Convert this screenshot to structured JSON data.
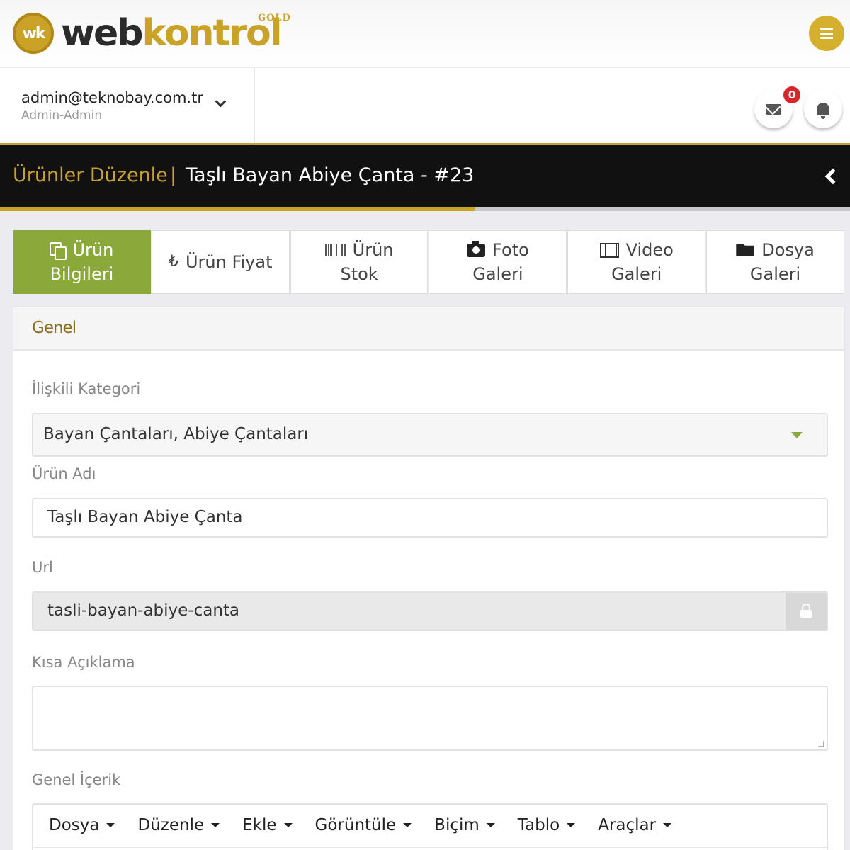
{
  "brand": {
    "badge_text": "wk",
    "name_part1": "web",
    "name_part2": "kontrol",
    "tier": "GOLD",
    "accent_color": "#c9a227"
  },
  "topbar": {
    "menu_icon": "hamburger-icon"
  },
  "user": {
    "email": "admin@teknobay.com.tr",
    "role": "Admin-Admin",
    "dropdown_icon": "chevron-down-icon"
  },
  "notifications": {
    "mail_count": "0",
    "mail_icon": "envelope-icon",
    "bell_icon": "bell-icon",
    "badge_color": "#d9262b"
  },
  "header": {
    "section": "Ürünler Düzenle",
    "separator": "|",
    "title": "Taşlı Bayan Abiye Çanta - #23",
    "back_icon": "chevron-left-icon",
    "progress_fraction": 0.558
  },
  "tabs": [
    {
      "line1": "Ürün",
      "line2": "Bilgileri",
      "icon": "copy-icon",
      "active": true
    },
    {
      "line1": "Ürün Fiyat",
      "line2": "",
      "icon": "lira-icon",
      "glyph": "₺",
      "active": false
    },
    {
      "line1": "Ürün",
      "line2": "Stok",
      "icon": "barcode-icon",
      "active": false
    },
    {
      "line1": "Foto",
      "line2": "Galeri",
      "icon": "camera-icon",
      "active": false
    },
    {
      "line1": "Video",
      "line2": "Galeri",
      "icon": "film-icon",
      "active": false
    },
    {
      "line1": "Dosya",
      "line2": "Galeri",
      "icon": "folder-open-icon",
      "active": false
    }
  ],
  "panel": {
    "title": "Genel",
    "fields": {
      "category": {
        "label": "İlişkili Kategori",
        "value": "Bayan Çantaları, Abiye Çantaları"
      },
      "name": {
        "label": "Ürün Adı",
        "value": "Taşlı Bayan Abiye Çanta"
      },
      "url": {
        "label": "Url",
        "value": "tasli-bayan-abiye-canta",
        "lock_icon": "lock-icon"
      },
      "short_desc": {
        "label": "Kısa Açıklama",
        "value": ""
      },
      "content": {
        "label": "Genel İçerik"
      }
    }
  },
  "editor": {
    "menus": [
      "Dosya",
      "Düzenle",
      "Ekle",
      "Görüntüle",
      "Biçim",
      "Tablo",
      "Araçlar"
    ]
  }
}
